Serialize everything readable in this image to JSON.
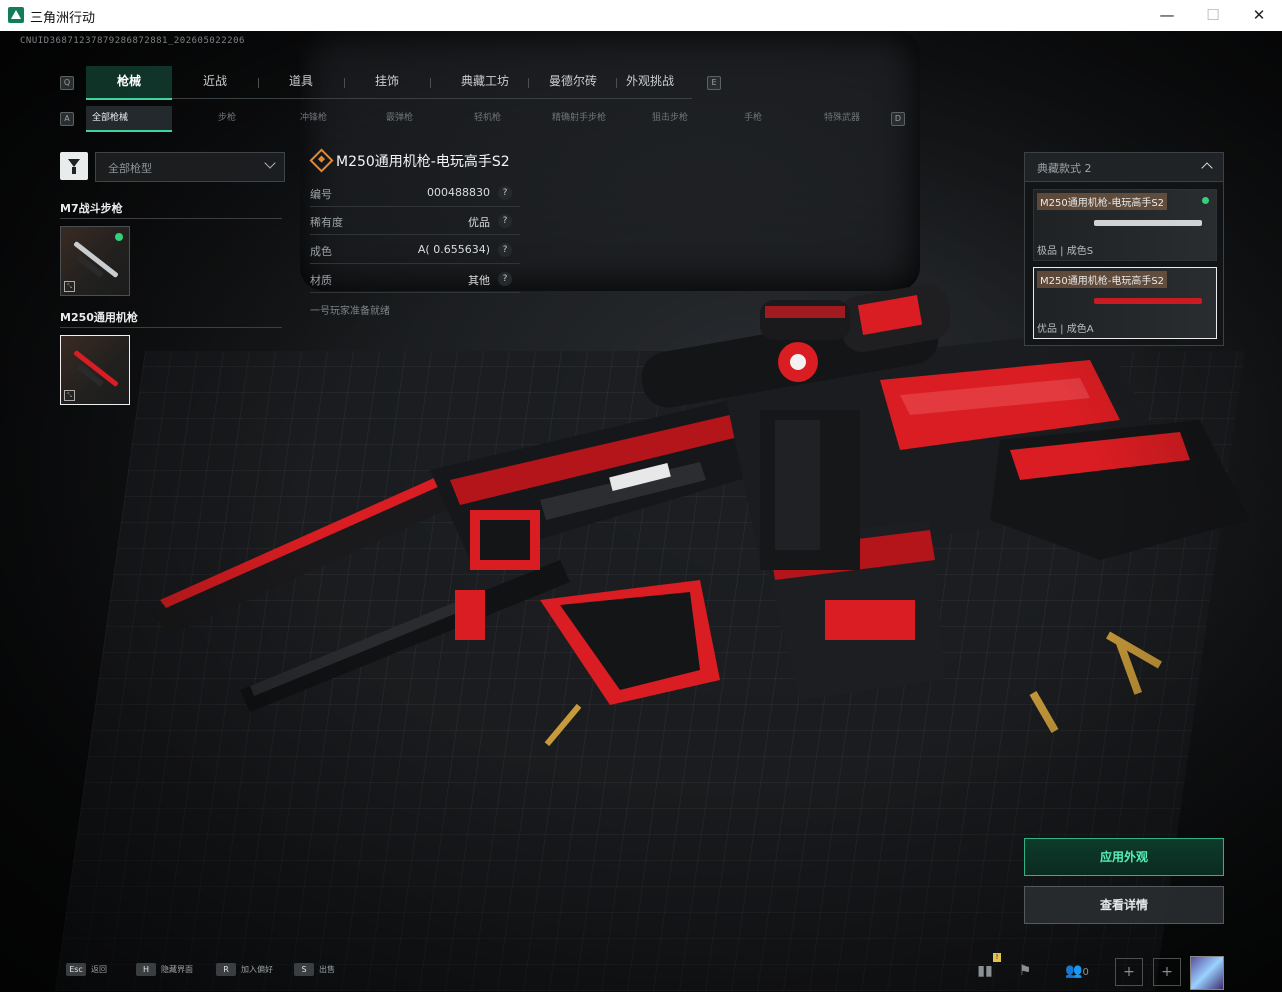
{
  "window": {
    "title": "三角洲行动",
    "min": "—",
    "max": "☐",
    "close": "✕"
  },
  "uid": "CNUID36871237879286872881_202605022206",
  "keys": {
    "left_main": "Q",
    "right_main": "E",
    "left_sub": "A",
    "right_sub": "D"
  },
  "tabs": [
    "枪械",
    "近战",
    "道具",
    "挂饰",
    "典藏工坊",
    "曼德尔砖",
    "外观挑战"
  ],
  "subtabs": [
    "全部枪械",
    "步枪",
    "冲锋枪",
    "霰弹枪",
    "轻机枪",
    "精确射手步枪",
    "狙击步枪",
    "手枪",
    "特殊武器"
  ],
  "filter": {
    "value": "全部枪型"
  },
  "groups": [
    {
      "title": "M7战斗步枪"
    },
    {
      "title": "M250通用机枪"
    }
  ],
  "info": {
    "title": "M250通用机枪-电玩高手S2",
    "rows": [
      {
        "label": "编号",
        "value": "000488830"
      },
      {
        "label": "稀有度",
        "value": "优品"
      },
      {
        "label": "成色",
        "value": "A( 0.655634)"
      },
      {
        "label": "材质",
        "value": "其他"
      }
    ],
    "help": "?",
    "desc": "一号玩家准备就绪"
  },
  "collection": {
    "label": "典藏款式 2",
    "items": [
      {
        "name": "M250通用机枪-电玩高手S2",
        "sub": "极品 | 成色S"
      },
      {
        "name": "M250通用机枪-电玩高手S2",
        "sub": "优品 | 成色A"
      }
    ]
  },
  "buttons": {
    "apply": "应用外观",
    "detail": "查看详情"
  },
  "hints": [
    {
      "key": "Esc",
      "label": "返回"
    },
    {
      "key": "H",
      "label": "隐藏界面"
    },
    {
      "key": "R",
      "label": "加入偏好"
    },
    {
      "key": "S",
      "label": "出售"
    }
  ],
  "bottom_right": {
    "badge": "!",
    "friends_count": "0"
  },
  "colors": {
    "accent": "#3fd3a0",
    "weapon_red": "#d91d22",
    "online": "#33d17a",
    "rarity": "#e08a33"
  }
}
